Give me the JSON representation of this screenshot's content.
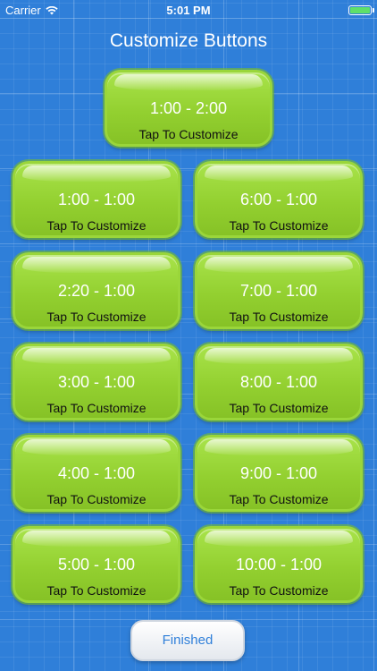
{
  "status_bar": {
    "carrier": "Carrier",
    "time": "5:01 PM",
    "battery_color": "#5ee06a"
  },
  "title": "Customize Buttons",
  "tiles": [
    {
      "time": "1:00 - 2:00",
      "subtitle": "Tap To Customize"
    },
    {
      "time": "1:00 - 1:00",
      "subtitle": "Tap To Customize"
    },
    {
      "time": "6:00 - 1:00",
      "subtitle": "Tap To Customize"
    },
    {
      "time": "2:20 - 1:00",
      "subtitle": "Tap To Customize"
    },
    {
      "time": "7:00 - 1:00",
      "subtitle": "Tap To Customize"
    },
    {
      "time": "3:00 - 1:00",
      "subtitle": "Tap To Customize"
    },
    {
      "time": "8:00 - 1:00",
      "subtitle": "Tap To Customize"
    },
    {
      "time": "4:00 - 1:00",
      "subtitle": "Tap To Customize"
    },
    {
      "time": "9:00 - 1:00",
      "subtitle": "Tap To Customize"
    },
    {
      "time": "5:00 - 1:00",
      "subtitle": "Tap To Customize"
    },
    {
      "time": "10:00 - 1:00",
      "subtitle": "Tap To Customize"
    }
  ],
  "finished_label": "Finished",
  "colors": {
    "background": "#2f7fd9",
    "tile": "#93d030",
    "finished_text": "#2f7fd9"
  }
}
